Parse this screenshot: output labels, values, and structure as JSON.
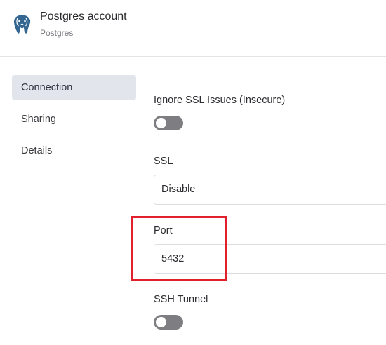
{
  "header": {
    "title": "Postgres account",
    "subtitle": "Postgres",
    "logo_icon": "postgres-elephant-icon"
  },
  "sidebar": {
    "items": [
      {
        "label": "Connection",
        "active": true
      },
      {
        "label": "Sharing",
        "active": false
      },
      {
        "label": "Details",
        "active": false
      }
    ]
  },
  "form": {
    "ignore_ssl": {
      "label": "Ignore SSL Issues (Insecure)",
      "enabled": false
    },
    "ssl": {
      "label": "SSL",
      "value": "Disable"
    },
    "port": {
      "label": "Port",
      "value": "5432"
    },
    "ssh_tunnel": {
      "label": "SSH Tunnel",
      "enabled": false
    }
  },
  "colors": {
    "highlight": "#e0202a",
    "active_sidebar": "#e3e5ec",
    "toggle_off": "#7e7e82"
  }
}
